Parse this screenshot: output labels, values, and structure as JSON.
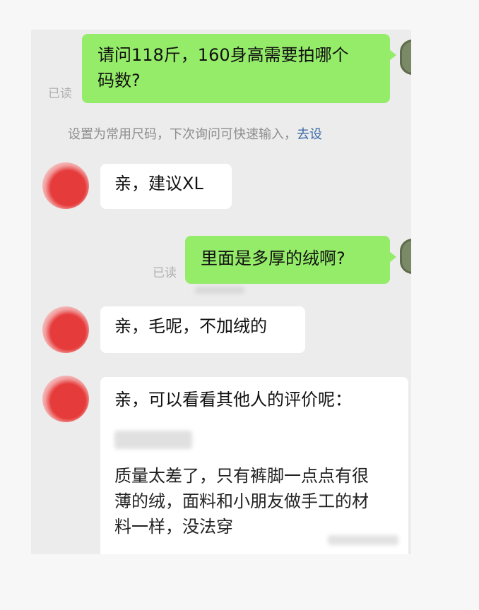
{
  "messages": {
    "m1": "请问118斤，160身高需要拍哪个码数?",
    "m1_line1": "请问118斤，160身高需要拍哪个",
    "m1_line2": "码数?",
    "r1": "亲，建议XL",
    "m2": "里面是多厚的绒啊?",
    "r2": "亲，毛呢，不加绒的",
    "r3_line1": "亲，可以看看其他人的评价呢：",
    "review_line1": "质量太差了，只有裤脚一点点有很",
    "review_line2": "薄的绒，面料和小朋友做手工的材",
    "review_line3": "料一样，没法穿"
  },
  "status": {
    "read_label": "已读"
  },
  "hint": {
    "text": "设置为常用尺码，下次询问可快速输入，",
    "link": "去设"
  },
  "colors": {
    "my_bubble": "#95ec69",
    "their_bubble": "#ffffff",
    "background": "#ececec",
    "link": "#3b6aa6"
  },
  "icons": {
    "my_avatar": "avatar-icon",
    "their_avatar": "shop-avatar-icon"
  }
}
